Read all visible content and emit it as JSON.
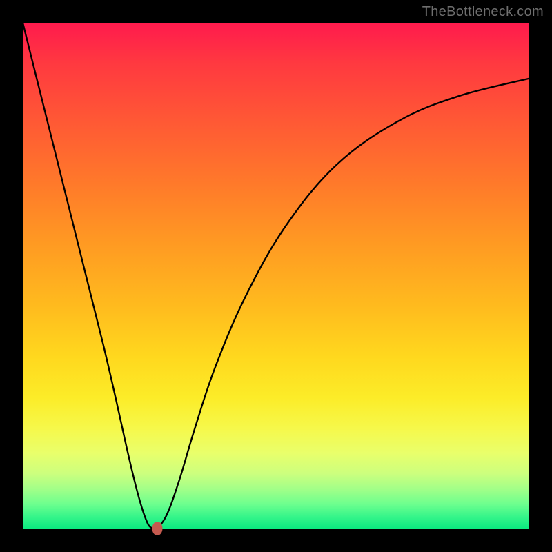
{
  "watermark": "TheBottleneck.com",
  "chart_data": {
    "type": "line",
    "title": "",
    "xlabel": "",
    "ylabel": "",
    "xlim": [
      0,
      100
    ],
    "ylim": [
      0,
      100
    ],
    "grid": false,
    "series": [
      {
        "name": "curve",
        "x": [
          0,
          8,
          16,
          21,
          23,
          24.5,
          25.5,
          26.5,
          28.5,
          31,
          34,
          38,
          44,
          52,
          62,
          74,
          86,
          100
        ],
        "y": [
          100,
          68,
          36,
          14,
          6,
          1.5,
          0.2,
          0.2,
          3,
          10,
          20,
          32,
          46,
          60,
          72,
          80.5,
          85.5,
          89
        ]
      }
    ],
    "marker": {
      "x": 26.5,
      "y": 0.2,
      "color": "#c55a4f"
    },
    "gradient_stops": [
      {
        "pos": 0,
        "color": "#ff1a4d"
      },
      {
        "pos": 50,
        "color": "#ffbb1e"
      },
      {
        "pos": 80,
        "color": "#f6f84a"
      },
      {
        "pos": 100,
        "color": "#09e97f"
      }
    ]
  }
}
